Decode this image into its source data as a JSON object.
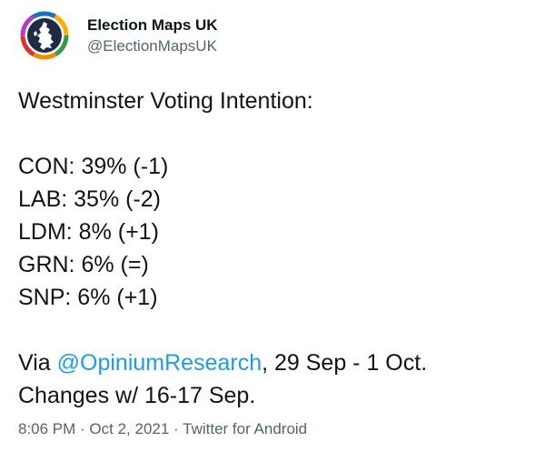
{
  "author": {
    "display_name": "Election Maps UK",
    "handle": "@ElectionMapsUK",
    "avatar_icon": "election-maps-uk-logo-icon"
  },
  "tweet": {
    "heading": "Westminster Voting Intention:",
    "polls": [
      "CON: 39% (-1)",
      "LAB: 35% (-2)",
      "LDM: 8% (+1)",
      "GRN: 6% (=)",
      "SNP: 6% (+1)"
    ],
    "via_prefix": "Via ",
    "mention": "@OpiniumResearch",
    "via_suffix": ", 29 Sep - 1 Oct.",
    "changes": "Changes w/ 16-17 Sep."
  },
  "meta": {
    "time": "8:06 PM",
    "separator": " · ",
    "date": "Oct 2, 2021",
    "source": "Twitter for Android"
  },
  "colors": {
    "text": "#0f1419",
    "secondary": "#536471",
    "link": "#1d9bf0"
  }
}
